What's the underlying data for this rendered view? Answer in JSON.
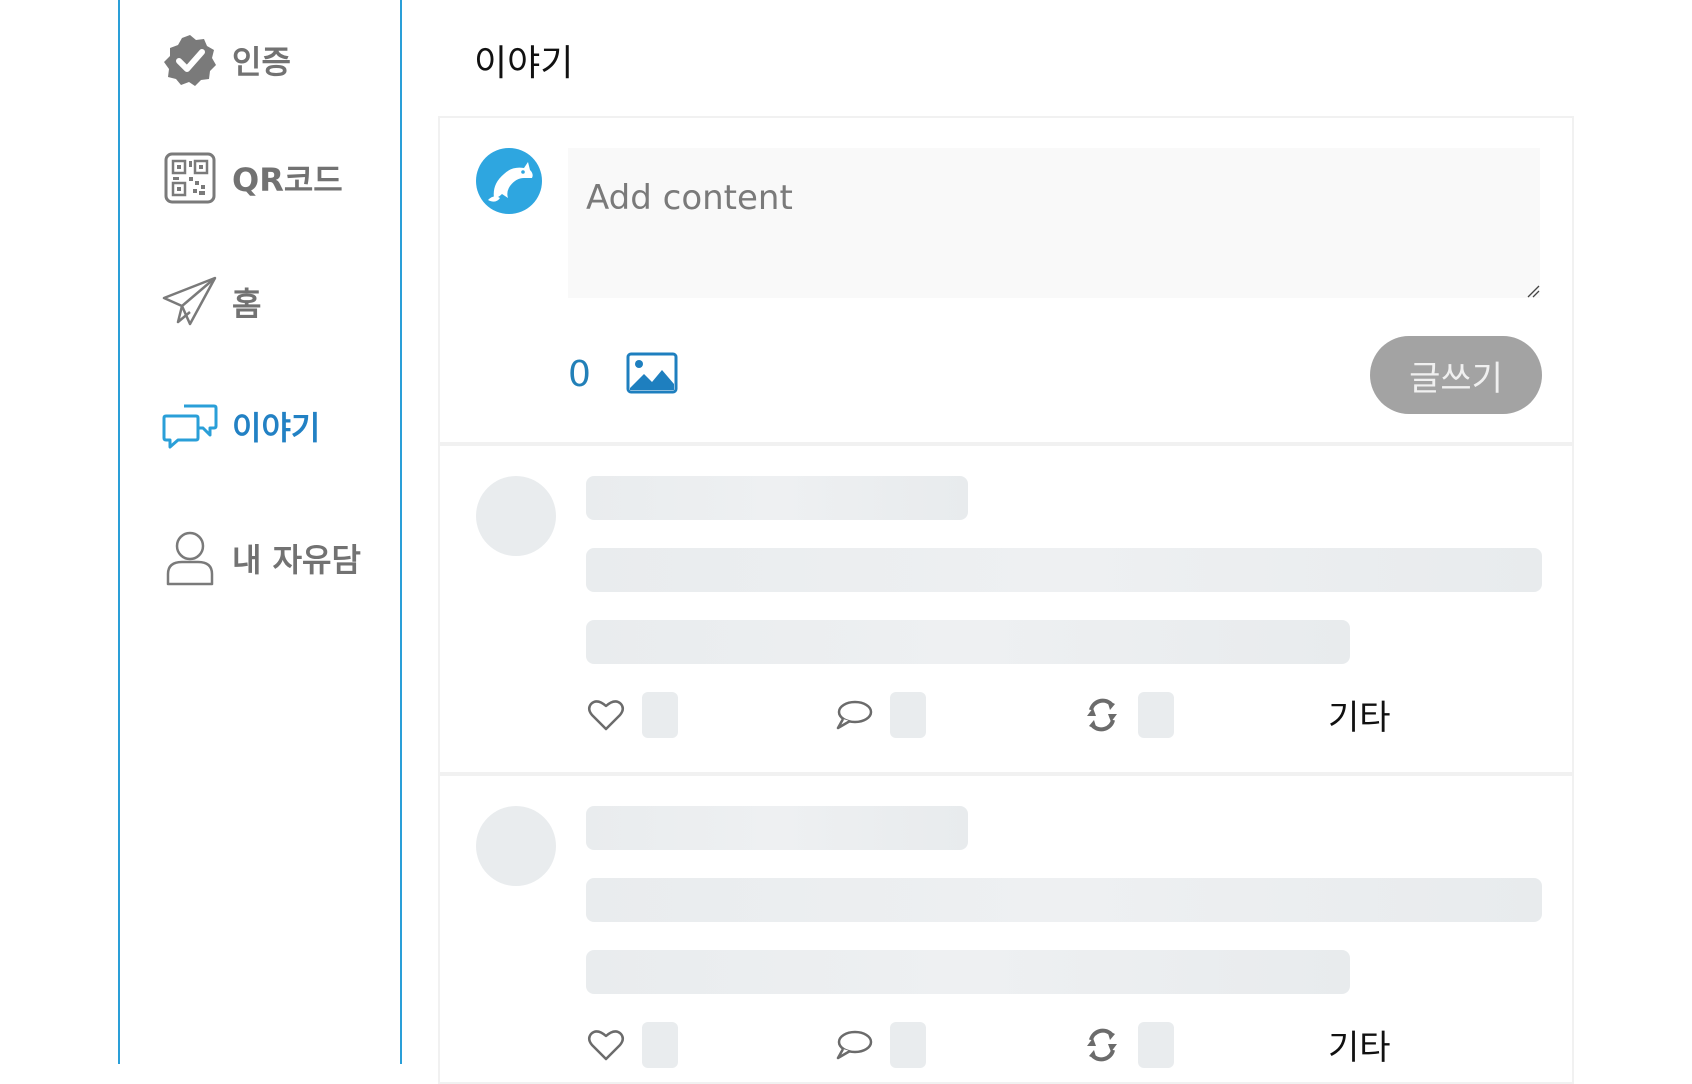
{
  "sidebar": {
    "items": [
      {
        "label": "인증",
        "icon": "verified-badge-icon",
        "active": false
      },
      {
        "label": "QR코드",
        "icon": "qr-code-icon",
        "active": false
      },
      {
        "label": "홈",
        "icon": "paper-plane-icon",
        "active": false
      },
      {
        "label": "이야기",
        "icon": "chat-bubbles-icon",
        "active": true
      },
      {
        "label": "내 자유담",
        "icon": "user-icon",
        "active": false
      }
    ]
  },
  "main": {
    "title": "이야기",
    "composer": {
      "placeholder": "Add content",
      "char_count": "0",
      "image_icon": "image-icon",
      "submit_label": "글쓰기",
      "avatar_icon": "dolphin-logo-icon"
    },
    "feed": [
      {
        "more_label": "기타",
        "like_icon": "heart-icon",
        "comment_icon": "comment-icon",
        "share_icon": "repost-icon"
      },
      {
        "more_label": "기타",
        "like_icon": "heart-icon",
        "comment_icon": "comment-icon",
        "share_icon": "repost-icon"
      }
    ]
  },
  "colors": {
    "accent": "#2281c4",
    "sidebar_border": "#2a9fd8",
    "button_gray": "#a3a3a3",
    "skeleton": "#e9ecee"
  }
}
